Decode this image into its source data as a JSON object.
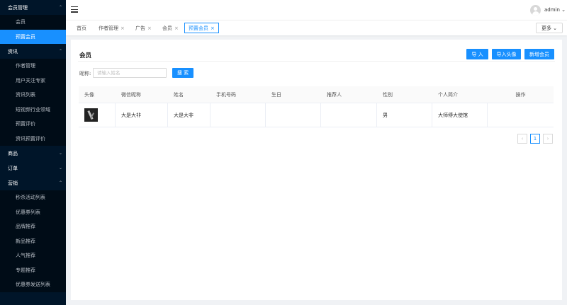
{
  "sidebar": [
    {
      "label": "会员管理",
      "expanded": true,
      "items": [
        {
          "label": "会员",
          "active": false
        },
        {
          "label": "预置会员",
          "active": true
        }
      ]
    },
    {
      "label": "资讯",
      "expanded": true,
      "items": [
        {
          "label": "作者管理",
          "active": false
        },
        {
          "label": "用户关注专家",
          "active": false
        },
        {
          "label": "资讯列表",
          "active": false
        },
        {
          "label": "短视频行业领域",
          "active": false
        },
        {
          "label": "预置评价",
          "active": false
        },
        {
          "label": "资讯预置评价",
          "active": false
        }
      ]
    },
    {
      "label": "商品",
      "expanded": false,
      "items": []
    },
    {
      "label": "订单",
      "expanded": false,
      "items": []
    },
    {
      "label": "营销",
      "expanded": true,
      "items": [
        {
          "label": "秒杀活动列表",
          "active": false
        },
        {
          "label": "优惠券列表",
          "active": false
        },
        {
          "label": "品牌推荐",
          "active": false
        },
        {
          "label": "新品推荐",
          "active": false
        },
        {
          "label": "人气推荐",
          "active": false
        },
        {
          "label": "专题推荐",
          "active": false
        },
        {
          "label": "优惠券发送列表",
          "active": false
        }
      ]
    }
  ],
  "header": {
    "username": "admin",
    "user_chevron": "⌄"
  },
  "tabs": [
    {
      "label": "首页",
      "closable": false,
      "active": false
    },
    {
      "label": "作者管理",
      "closable": true,
      "active": false
    },
    {
      "label": "广告",
      "closable": true,
      "active": false
    },
    {
      "label": "会员",
      "closable": true,
      "active": false
    },
    {
      "label": "预置会员",
      "closable": true,
      "active": true
    }
  ],
  "tab_close": "×",
  "more_label": "更多 ⌄",
  "panel": {
    "title": "会员",
    "buttons": {
      "import": "导 入",
      "import_avatar": "导入头像",
      "add": "新增会员"
    },
    "filter": {
      "label": "昵称:",
      "placeholder": "请输入姓名",
      "value": "",
      "search": "搜 索"
    }
  },
  "table": {
    "columns": [
      "头像",
      "微信昵称",
      "姓名",
      "手机号码",
      "生日",
      "推荐人",
      "性别",
      "个人简介",
      "操作"
    ],
    "rows": [
      {
        "nickname": "大是大非",
        "name": "大是大非",
        "phone": "",
        "birthday": "",
        "referrer": "",
        "gender": "男",
        "bio": "大师傅大使馆",
        "actions": ""
      }
    ]
  },
  "pagination": {
    "prev": "‹",
    "current": "1",
    "next": "›"
  },
  "colors": {
    "sidebar_bg": "#001529",
    "sidebar_sub_bg": "#000c17",
    "accent": "#1890ff",
    "page_bg": "#f0f2f5"
  }
}
